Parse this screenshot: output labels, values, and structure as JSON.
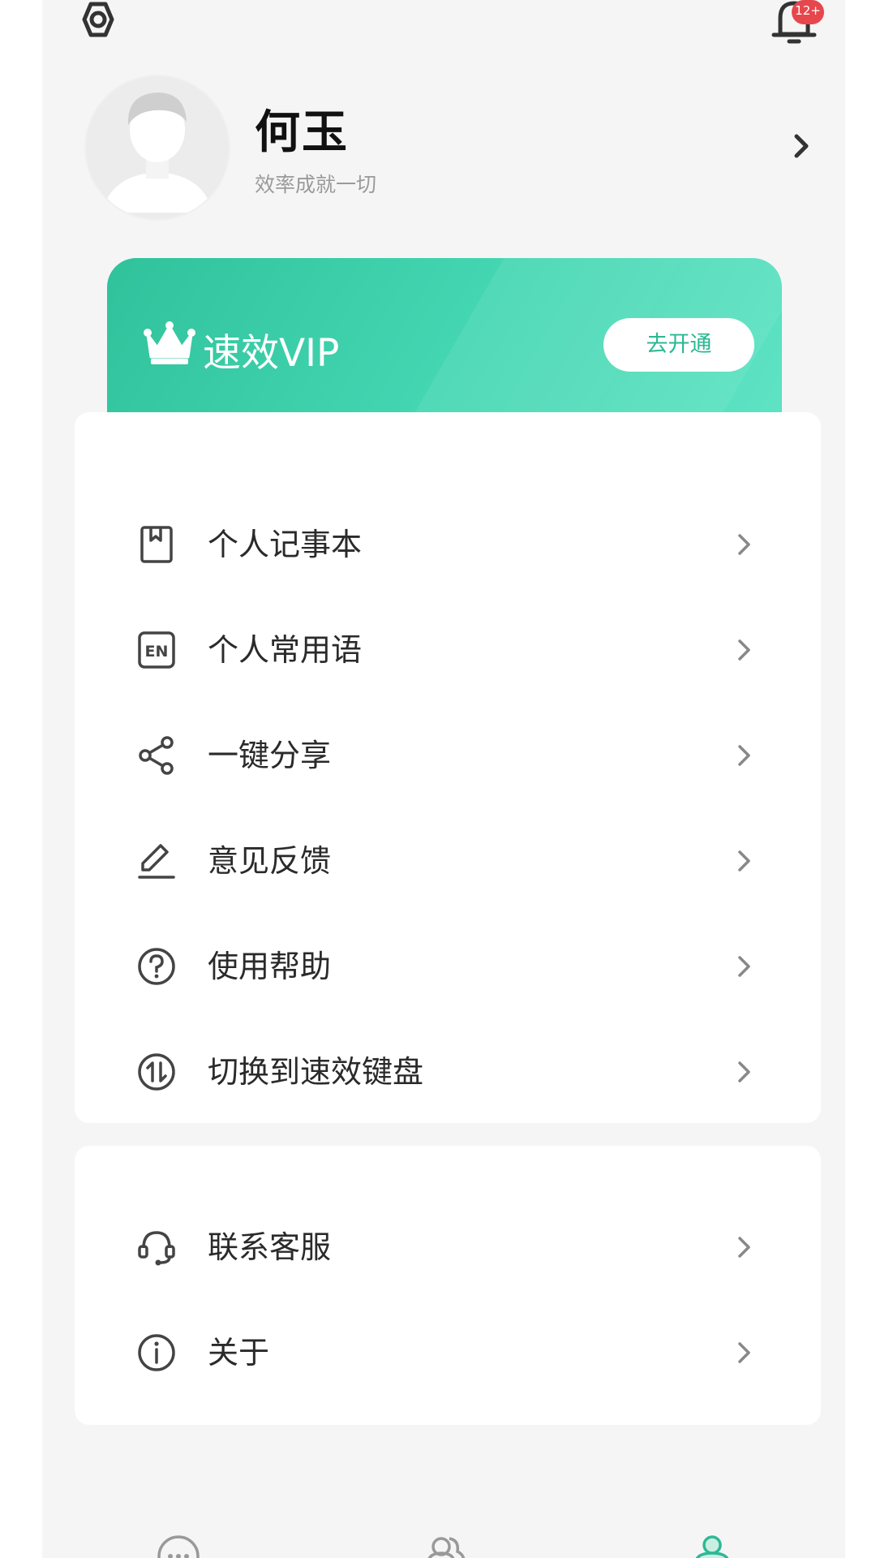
{
  "notifications": {
    "badge": "12+"
  },
  "profile": {
    "name": "何玉",
    "slogan": "效率成就一切"
  },
  "vip": {
    "title": "速效VIP",
    "button": "去开通"
  },
  "menu": {
    "items": [
      {
        "label": "个人记事本",
        "icon": "notebook-icon"
      },
      {
        "label": "个人常用语",
        "icon": "en-phrases-icon"
      },
      {
        "label": "一键分享",
        "icon": "share-icon"
      },
      {
        "label": "意见反馈",
        "icon": "edit-feedback-icon"
      },
      {
        "label": "使用帮助",
        "icon": "help-icon"
      },
      {
        "label": "切换到速效键盘",
        "icon": "switch-icon"
      }
    ],
    "secondary": [
      {
        "label": "联系客服",
        "icon": "headset-icon"
      },
      {
        "label": "关于",
        "icon": "info-icon"
      }
    ]
  },
  "tabbar": {
    "items": [
      "chat-icon",
      "contacts-icon",
      "profile-icon"
    ],
    "active": "profile-icon"
  },
  "colors": {
    "accent": "#2fc29b",
    "badge": "#e6474c",
    "background": "#f5f5f6"
  }
}
